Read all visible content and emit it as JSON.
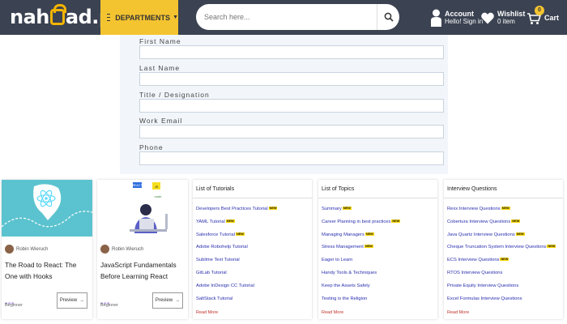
{
  "header": {
    "logo_text": "nahead.pk",
    "departments_label": "DEPARTMENTS",
    "search_placeholder": "Search here...",
    "account_title": "Account",
    "account_sub": "Hello! Sign in",
    "wishlist_title": "Wishlist",
    "wishlist_sub": "0 item",
    "cart_label": "Cart",
    "cart_count": "0",
    "colors": {
      "bar": "#3b4251",
      "accent": "#f4c430"
    }
  },
  "form": {
    "fields": [
      {
        "label": "First Name"
      },
      {
        "label": "Last Name"
      },
      {
        "label": "Title / Designation"
      },
      {
        "label": "Work Email"
      },
      {
        "label": "Phone"
      }
    ]
  },
  "courses": [
    {
      "author": "Robin Wieruch",
      "title": "The Road to React: The One with Hooks",
      "level": "Beginner",
      "preview_label": "Preview",
      "image_icon": "react-logo-icon"
    },
    {
      "author": "Robin Wieruch",
      "title": "JavaScript Fundamentals Before Learning React",
      "level": "Beginner",
      "preview_label": "Preview",
      "image_icon": "developer-laptop-icon",
      "image_tags": [
        "REACT",
        "JS",
        "node"
      ]
    }
  ],
  "lists": [
    {
      "title": "List of Tutorials",
      "items": [
        {
          "text": "Developers Best Practices Tutorial",
          "new": true
        },
        {
          "text": "YAML Tutorial",
          "new": true
        },
        {
          "text": "Salesforce Tutorial",
          "new": true
        },
        {
          "text": "Adobe Robohelp Tutorial",
          "new": false
        },
        {
          "text": "Sublime Text Tutorial",
          "new": false
        },
        {
          "text": "GitLab Tutorial",
          "new": false
        },
        {
          "text": "Adobe InDesign CC Tutorial",
          "new": false
        },
        {
          "text": "SaltStack Tutorial",
          "new": false
        }
      ],
      "read_more": "Read More"
    },
    {
      "title": "List of Topics",
      "items": [
        {
          "text": "Summary",
          "new": true
        },
        {
          "text": "Career Planning in best practices",
          "new": true
        },
        {
          "text": "Managing Managers",
          "new": true
        },
        {
          "text": "Stress Management",
          "new": true
        },
        {
          "text": "Eager to Learn",
          "new": false
        },
        {
          "text": "Handy Tools & Techniques",
          "new": false
        },
        {
          "text": "Keep the Assets Safely",
          "new": false
        },
        {
          "text": "Testing is the Religion",
          "new": false
        }
      ],
      "read_more": "Read More"
    },
    {
      "title": "Interview Questions",
      "items": [
        {
          "text": "Rexx Interview Questions",
          "new": true
        },
        {
          "text": "Cobertura Interview Questions",
          "new": true
        },
        {
          "text": "Java Quartz Interview Questions",
          "new": true
        },
        {
          "text": "Cheque Truncation System Interview Questions",
          "new": true
        },
        {
          "text": "ECS Interview Questions",
          "new": true
        },
        {
          "text": "RTOS Interview Questions",
          "new": false
        },
        {
          "text": "Private Equity Interview Questions",
          "new": false
        },
        {
          "text": "Excel Formulas Interview Questions",
          "new": false
        }
      ],
      "read_more": "Read More"
    }
  ],
  "new_badge": "NEW"
}
